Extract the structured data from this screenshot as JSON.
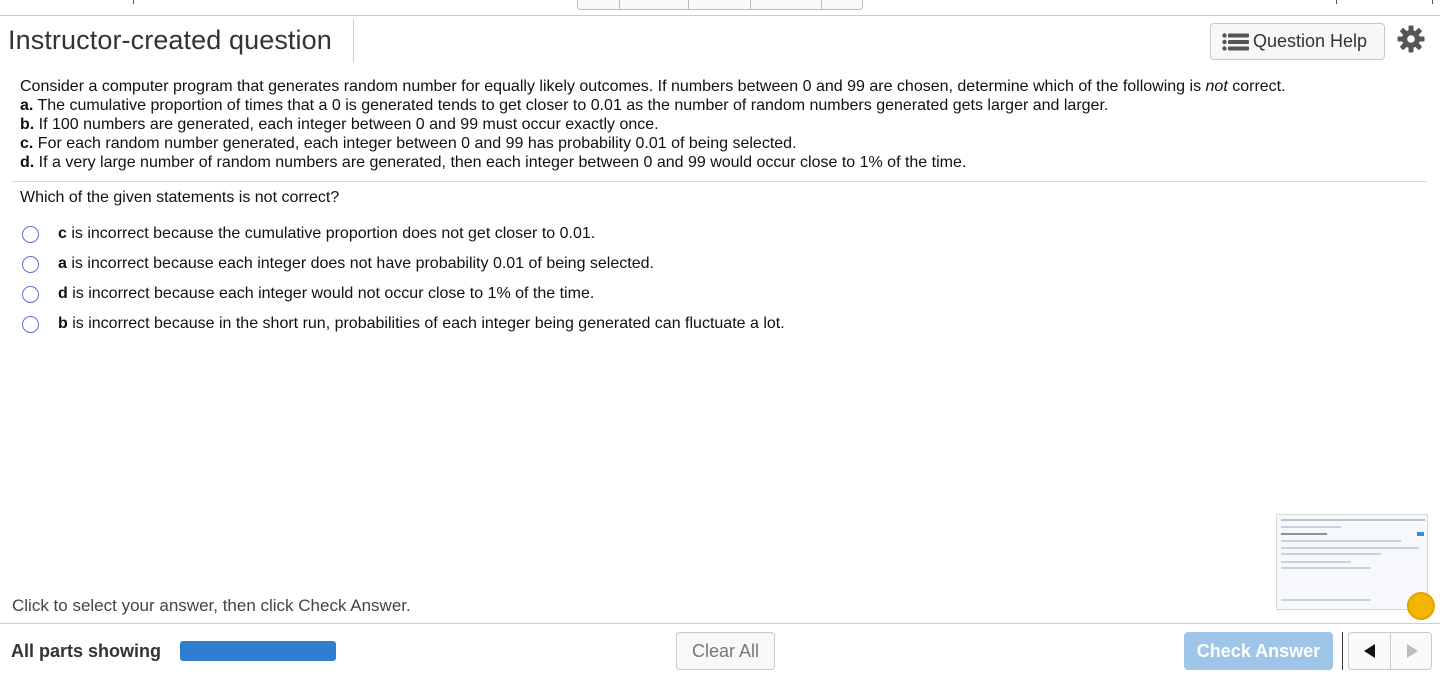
{
  "header": {
    "title": "Instructor-created question",
    "help_label": "Question Help"
  },
  "question": {
    "intro_before": "Consider a computer program that generates random number for equally likely outcomes. If numbers between 0 and 99 are chosen, determine which of the following is ",
    "intro_emphasis": "not",
    "intro_after": " correct.",
    "statements": [
      {
        "letter": "a.",
        "text": " The cumulative proportion of times that a 0 is generated tends to get closer to 0.01 as the number of random numbers generated gets larger and larger."
      },
      {
        "letter": "b.",
        "text": " If 100 numbers are generated, each integer between 0 and 99 must occur exactly once."
      },
      {
        "letter": "c.",
        "text": " For each random number generated, each integer between 0 and 99 has probability 0.01 of being selected."
      },
      {
        "letter": "d.",
        "text": " If a very large number of random numbers are generated, then each integer between 0 and 99 would occur close to 1% of the time."
      }
    ],
    "prompt": "Which of the given statements is not correct?"
  },
  "options": [
    {
      "letter": "c",
      "text": " is incorrect because the cumulative proportion does not get closer to 0.01."
    },
    {
      "letter": "a",
      "text": " is incorrect because each integer does not have probability 0.01 of being selected."
    },
    {
      "letter": "d",
      "text": " is incorrect because each integer would not occur close to 1% of the time."
    },
    {
      "letter": "b",
      "text": " is incorrect because in the short run, probabilities of each integer being generated can fluctuate a lot."
    }
  ],
  "footer": {
    "instruction": "Click to select your answer, then click Check Answer.",
    "parts_label": "All parts showing",
    "progress_fraction": 1.0,
    "clear_label": "Clear All",
    "check_label": "Check Answer"
  },
  "colors": {
    "accent_blue": "#2f7fd1",
    "radio_border": "#5a6fd6",
    "check_disabled": "#9fc5e8"
  }
}
